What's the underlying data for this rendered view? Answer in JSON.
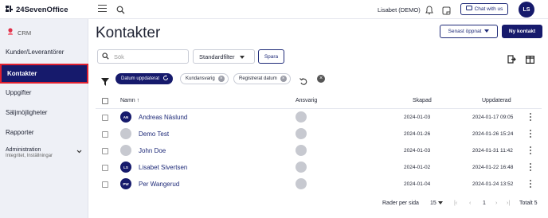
{
  "topbar": {
    "logo_text": "24SevenOffice",
    "user_name": "Lisabet (DEMO)",
    "chat_label": "Chat with us",
    "avatar_initials": "LS"
  },
  "sidebar": {
    "module": "CRM",
    "items": [
      {
        "label": "Kunder/Leverantörer"
      },
      {
        "label": "Kontakter"
      },
      {
        "label": "Uppgifter"
      },
      {
        "label": "Säljmöjligheter"
      },
      {
        "label": "Rapporter"
      }
    ],
    "admin": {
      "label": "Administration",
      "sub": "Integritet, Inställningar"
    }
  },
  "header": {
    "title": "Kontakter",
    "recent_label": "Senast öppnat",
    "new_label": "Ny kontakt"
  },
  "toolbar": {
    "search_placeholder": "Sök",
    "filter_label": "Standardfilter",
    "save_label": "Spara"
  },
  "chips": [
    {
      "label": "Datum uppdaterat",
      "active": true
    },
    {
      "label": "Kundansvarig",
      "active": false
    },
    {
      "label": "Registrerat datum",
      "active": false
    }
  ],
  "table": {
    "columns": {
      "name": "Namn",
      "name_sort": "↑",
      "responsible": "Ansvarig",
      "created": "Skapad",
      "updated": "Uppdaterad"
    },
    "rows": [
      {
        "initials": "AN",
        "name": "Andreas Näslund",
        "created": "2024-01-03",
        "updated": "2024-01-17 09:05",
        "style": "dark"
      },
      {
        "initials": "",
        "name": "Demo Test",
        "created": "2024-01-26",
        "updated": "2024-01-26 15:24",
        "style": "gray"
      },
      {
        "initials": "",
        "name": "John Doe",
        "created": "2024-01-03",
        "updated": "2024-01-31 11:42",
        "style": "gray"
      },
      {
        "initials": "LS",
        "name": "Lisabet Sivertsen",
        "created": "2024-01-02",
        "updated": "2024-01-22 16:48",
        "style": "dark"
      },
      {
        "initials": "PW",
        "name": "Per Wangerud",
        "created": "2024-01-04",
        "updated": "2024-01-24 13:52",
        "style": "dark"
      }
    ]
  },
  "pagination": {
    "rows_per_page_label": "Rader per sida",
    "rows_per_page": "15",
    "current_page": "1",
    "total": "Totalt 5"
  }
}
